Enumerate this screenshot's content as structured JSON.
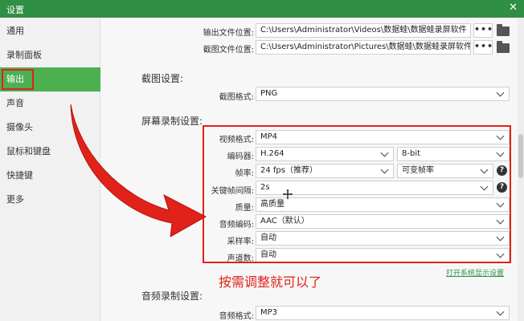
{
  "window": {
    "title": "设置",
    "close": "✕"
  },
  "sidebar": {
    "items": [
      {
        "label": "通用"
      },
      {
        "label": "录制面板"
      },
      {
        "label": "输出"
      },
      {
        "label": "声音"
      },
      {
        "label": "摄像头"
      },
      {
        "label": "鼠标和键盘"
      },
      {
        "label": "快捷键"
      },
      {
        "label": "更多"
      }
    ]
  },
  "output": {
    "output_path_label": "输出文件位置:",
    "output_path": "C:\\Users\\Administrator\\Videos\\数据蛙\\数据蛙录屏软件",
    "screenshot_path_label": "截图文件位置:",
    "screenshot_path": "C:\\Users\\Administrator\\Pictures\\数据蛙\\数据蛙录屏软件",
    "dots": "•••"
  },
  "screenshot_settings": {
    "section_title": "截图设置:",
    "format_label": "截图格式:",
    "format_value": "PNG"
  },
  "screen_recording": {
    "section_title": "屏幕录制设置:",
    "video_format_label": "视频格式:",
    "video_format": "MP4",
    "encoder_label": "编码器:",
    "encoder": "H.264",
    "bit_depth": "8-bit",
    "frame_rate_label": "帧率:",
    "frame_rate": "24 fps（推荐）",
    "frame_rate_mode": "可变帧率",
    "keyframe_label": "关键帧间隔:",
    "keyframe": "2s",
    "quality_label": "质量:",
    "quality": "高质量",
    "audio_codec_label": "音频编码:",
    "audio_codec": "AAC（默认）",
    "sample_rate_label": "采样率:",
    "sample_rate": "自动",
    "channels_label": "声道数:",
    "channels": "自动",
    "help": "?"
  },
  "annotation": {
    "text": "按需调整就可以了"
  },
  "link": {
    "text": "打开系统显示设置"
  },
  "audio_recording": {
    "section_title": "音频录制设置:",
    "audio_format_label": "音频格式:",
    "audio_format": "MP3"
  },
  "colors": {
    "accent": "#4caf50",
    "titlebar": "#2f8f45",
    "highlight": "#e0221b"
  }
}
